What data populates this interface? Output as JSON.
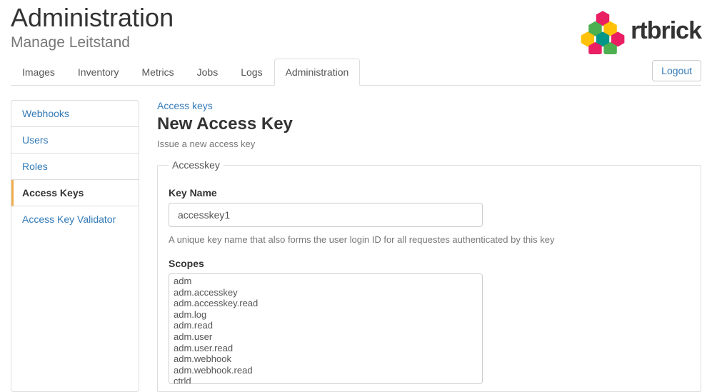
{
  "header": {
    "title": "Administration",
    "subtitle": "Manage Leitstand",
    "brand": "rtbrick"
  },
  "tabs": [
    {
      "label": "Images",
      "active": false
    },
    {
      "label": "Inventory",
      "active": false
    },
    {
      "label": "Metrics",
      "active": false
    },
    {
      "label": "Jobs",
      "active": false
    },
    {
      "label": "Logs",
      "active": false
    },
    {
      "label": "Administration",
      "active": true
    }
  ],
  "logout_label": "Logout",
  "sidebar": {
    "items": [
      {
        "label": "Webhooks",
        "active": false
      },
      {
        "label": "Users",
        "active": false
      },
      {
        "label": "Roles",
        "active": false
      },
      {
        "label": "Access Keys",
        "active": true
      },
      {
        "label": "Access Key Validator",
        "active": false
      }
    ]
  },
  "content": {
    "breadcrumb": "Access keys",
    "title": "New Access Key",
    "description": "Issue a new access key",
    "fieldset_legend": "Accesskey",
    "key_name_label": "Key Name",
    "key_name_value": "accesskey1",
    "key_name_help": "A unique key name that also forms the user login ID for all requestes authenticated by this key",
    "scopes_label": "Scopes",
    "scopes": [
      "adm",
      "adm.accesskey",
      "adm.accesskey.read",
      "adm.log",
      "adm.read",
      "adm.user",
      "adm.user.read",
      "adm.webhook",
      "adm.webhook.read",
      "ctrld"
    ]
  }
}
